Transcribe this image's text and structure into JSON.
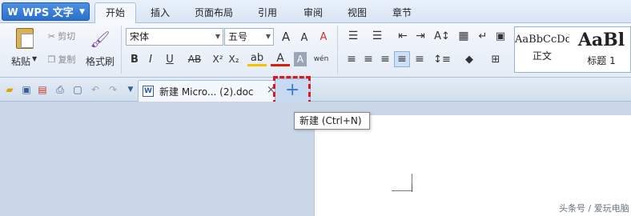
{
  "app": {
    "name": "WPS 文字"
  },
  "menu_tabs": [
    "开始",
    "插入",
    "页面布局",
    "引用",
    "审阅",
    "视图",
    "章节"
  ],
  "ribbon": {
    "clipboard": {
      "paste": "粘贴",
      "cut": "剪切",
      "copy": "复制",
      "format_painter": "格式刷"
    },
    "font": {
      "family": "宋体",
      "size": "五号"
    },
    "styles": [
      {
        "preview": "AaBbCcDd",
        "name": "正文"
      },
      {
        "preview": "AaBl",
        "name": "标题 1"
      }
    ]
  },
  "document_tab": {
    "title": "新建 Micro... (2).doc"
  },
  "tooltip": {
    "text": "新建 (Ctrl+N)"
  },
  "watermark": "头条号 / 爱玩电脑"
}
